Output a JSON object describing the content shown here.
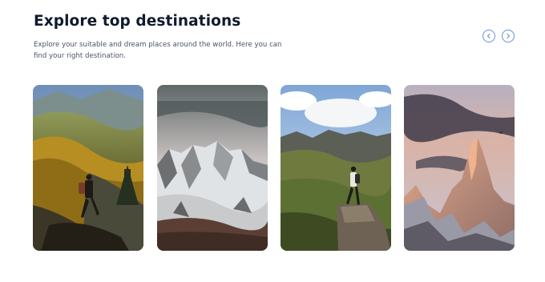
{
  "header": {
    "title": "Explore top destinations",
    "description": "Explore your suitable and dream places around the world. Here you can find your right destination."
  },
  "navigation": {
    "prev_icon": "chevron-left-icon",
    "next_icon": "chevron-right-icon",
    "accent_color": "#6d8fd6"
  },
  "destinations": [
    {
      "image": "autumn-valley-hiker"
    },
    {
      "image": "snowy-mountain-range"
    },
    {
      "image": "green-alpine-hiker"
    },
    {
      "image": "sunset-rock-peak"
    }
  ]
}
